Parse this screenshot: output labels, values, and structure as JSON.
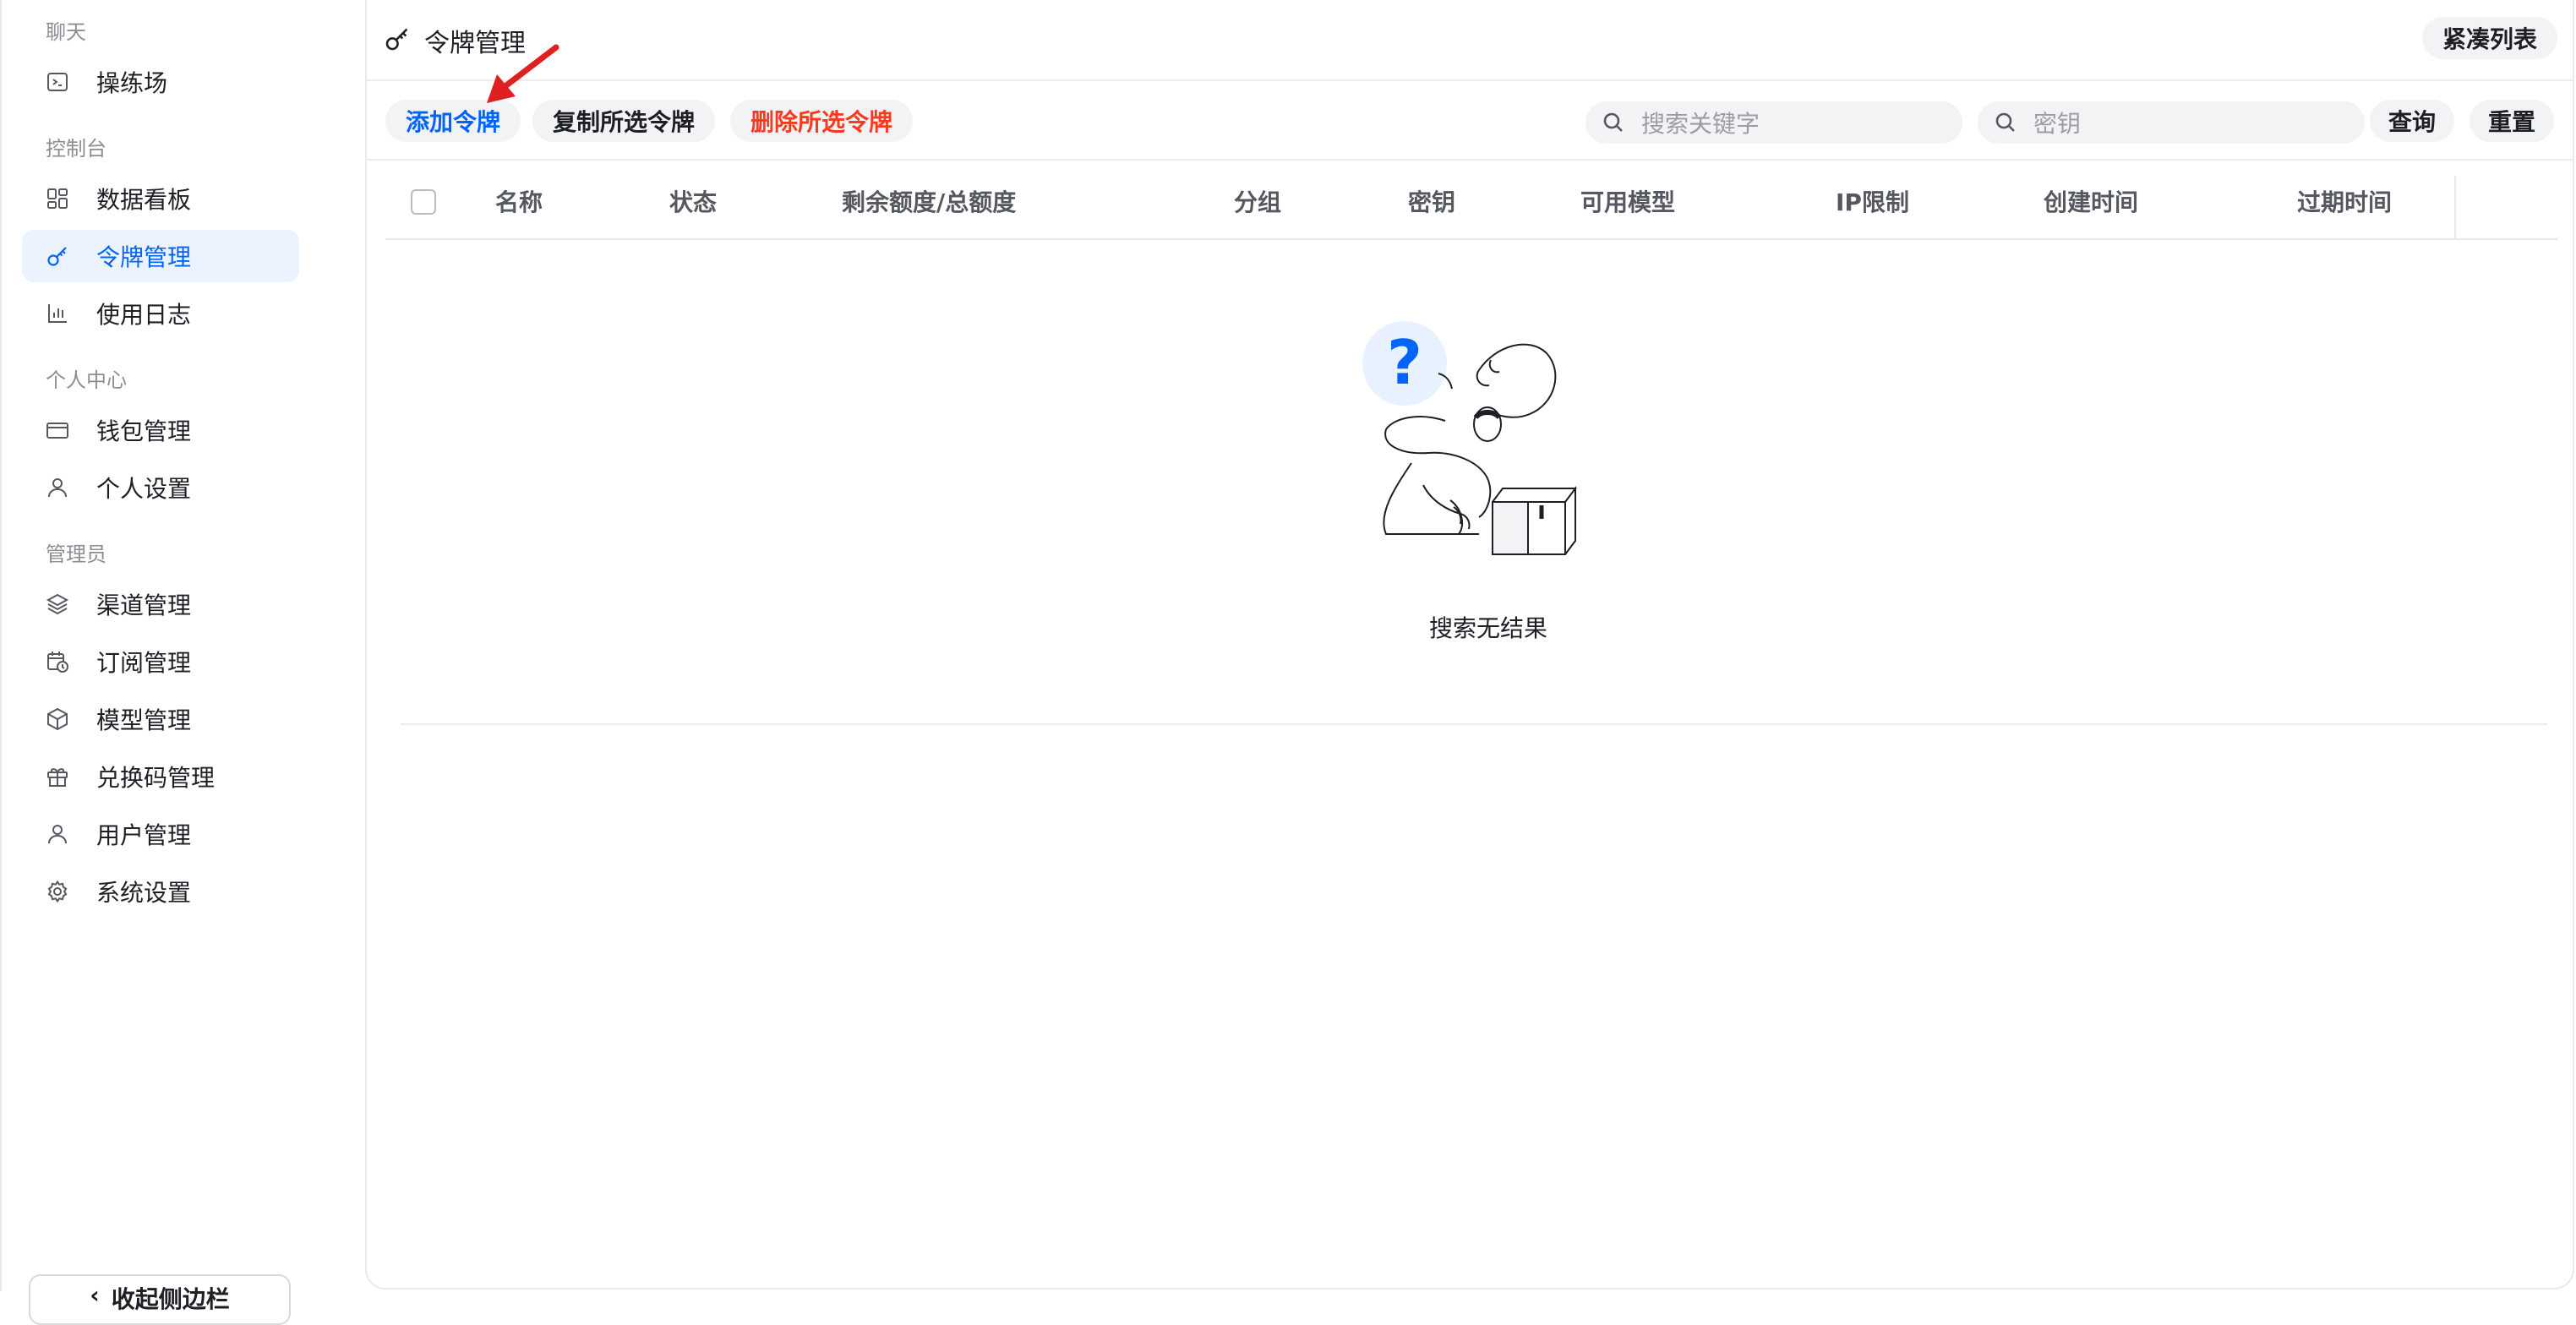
{
  "sidebar": {
    "groups": {
      "chat": "聊天",
      "console": "控制台",
      "personal": "个人中心",
      "admin": "管理员"
    },
    "items": [
      {
        "label": "操练场",
        "icon": "terminal-icon"
      },
      {
        "label": "数据看板",
        "icon": "dashboard-icon"
      },
      {
        "label": "令牌管理",
        "icon": "key-icon",
        "active": true
      },
      {
        "label": "使用日志",
        "icon": "bar-chart-icon"
      },
      {
        "label": "钱包管理",
        "icon": "wallet-icon"
      },
      {
        "label": "个人设置",
        "icon": "user-icon"
      },
      {
        "label": "渠道管理",
        "icon": "layers-icon"
      },
      {
        "label": "订阅管理",
        "icon": "calendar-clock-icon"
      },
      {
        "label": "模型管理",
        "icon": "box-icon"
      },
      {
        "label": "兑换码管理",
        "icon": "gift-icon"
      },
      {
        "label": "用户管理",
        "icon": "user-icon"
      },
      {
        "label": "系统设置",
        "icon": "gear-icon"
      }
    ],
    "collapse_label": "收起侧边栏"
  },
  "header": {
    "title": "令牌管理",
    "compact_list": "紧凑列表"
  },
  "toolbar": {
    "add_token": "添加令牌",
    "copy_selected": "复制所选令牌",
    "delete_selected": "删除所选令牌",
    "search_keyword_placeholder": "搜索关键字",
    "search_key_placeholder": "密钥",
    "query": "查询",
    "reset": "重置"
  },
  "table": {
    "columns": [
      "名称",
      "状态",
      "剩余额度/总额度",
      "分组",
      "密钥",
      "可用模型",
      "IP限制",
      "创建时间",
      "过期时间"
    ],
    "rows": [],
    "empty_text": "搜索无结果"
  },
  "colors": {
    "accent": "#0064fa",
    "danger": "#f93920",
    "active_bg": "#eaf3ff",
    "annotation": "#e02020"
  }
}
